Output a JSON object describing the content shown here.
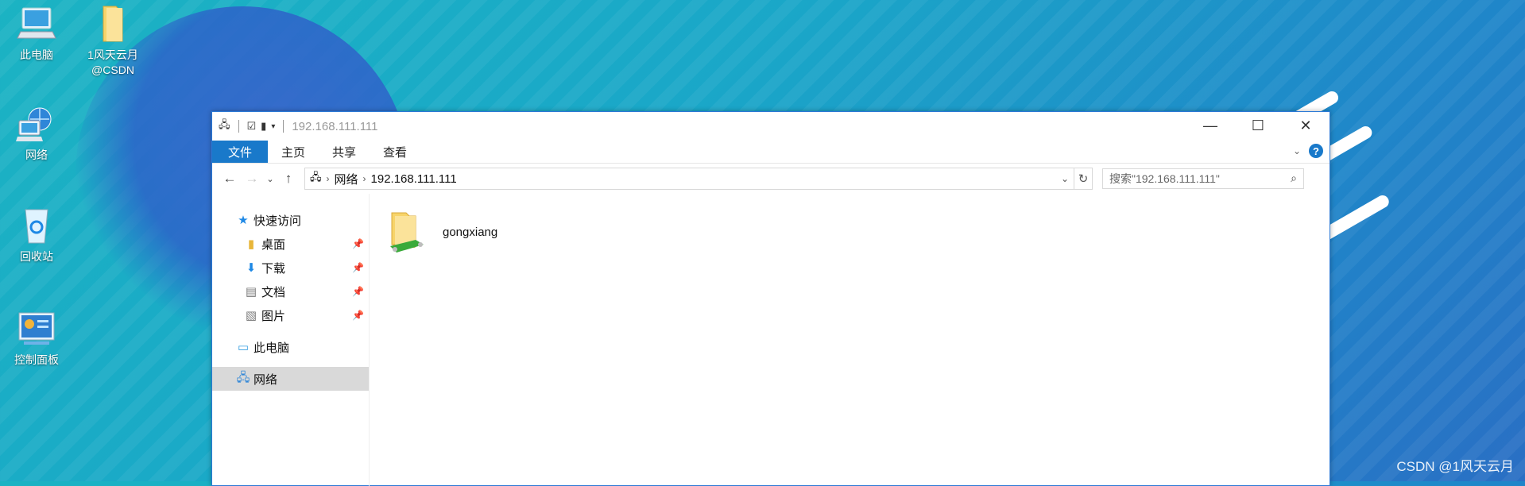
{
  "desktop": {
    "icons": [
      {
        "label": "此电脑",
        "icon": "computer-icon"
      },
      {
        "label": "1风天云月\n@CSDN",
        "icon": "folder-icon"
      },
      {
        "label": "网络",
        "icon": "network-icon"
      },
      {
        "label": "回收站",
        "icon": "recycle-bin-icon"
      },
      {
        "label": "控制面板",
        "icon": "control-panel-icon"
      }
    ]
  },
  "window": {
    "title": "192.168.111.111",
    "ribbon_tabs": [
      "文件",
      "主页",
      "共享",
      "查看"
    ],
    "address": {
      "root": "网络",
      "current": "192.168.111.111"
    },
    "search_placeholder": "搜索\"192.168.111.111\"",
    "sidebar": {
      "quick_access": "快速访问",
      "pinned": [
        "桌面",
        "下载",
        "文档",
        "图片"
      ],
      "this_pc": "此电脑",
      "network": "网络"
    },
    "items": [
      {
        "name": "gongxiang",
        "icon": "shared-folder-icon"
      }
    ]
  },
  "watermark": "CSDN @1风天云月",
  "colors": {
    "accent": "#1979ca",
    "selected": "#d9d9d9"
  }
}
